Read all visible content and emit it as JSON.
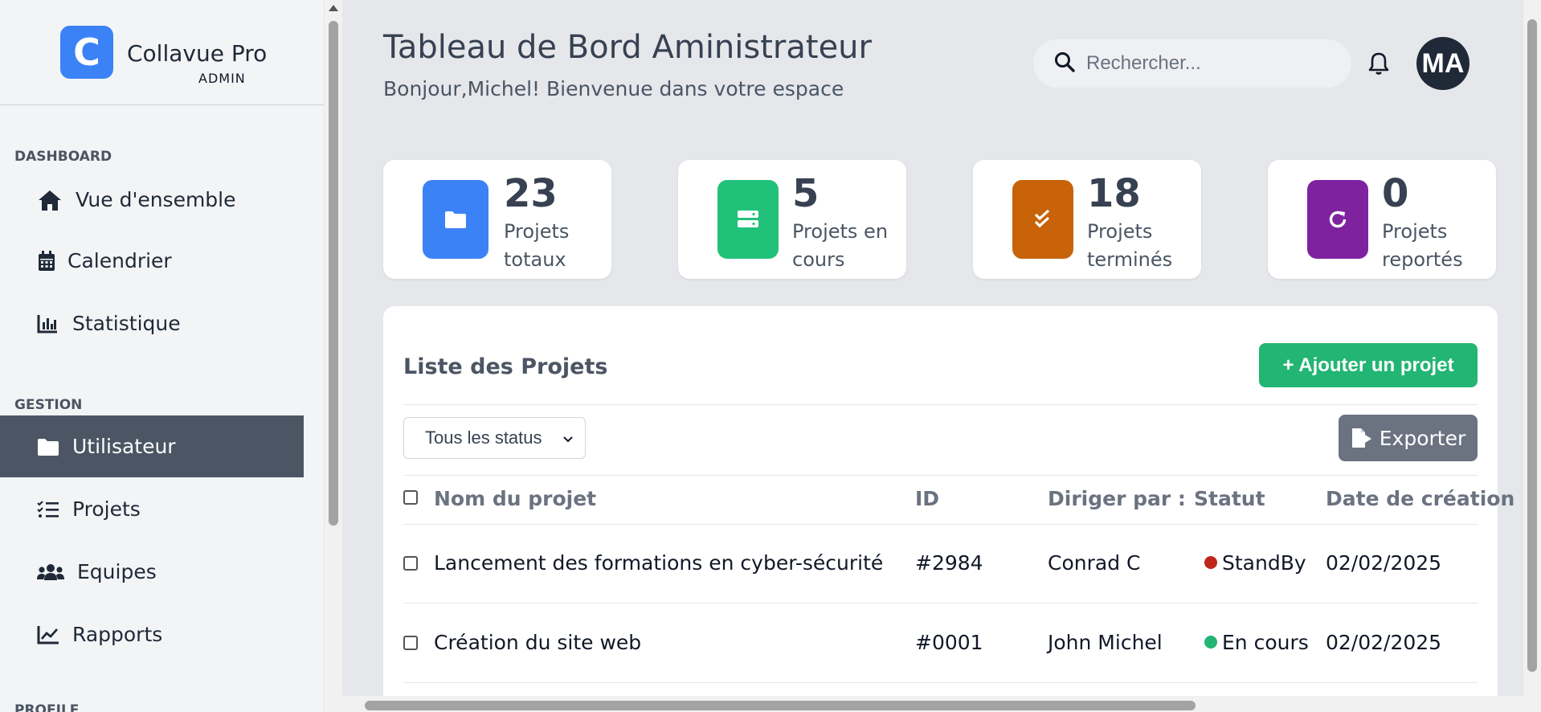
{
  "brand": {
    "logo_letter": "C",
    "name": "Collavue Pro",
    "role": "ADMIN",
    "color": "#3b82f6"
  },
  "sidebar": {
    "sections": [
      {
        "label": "DASHBOARD"
      },
      {
        "label": "GESTION"
      },
      {
        "label": "PROFILE"
      }
    ],
    "items": [
      {
        "label": "Vue d'ensemble",
        "icon": "home-icon"
      },
      {
        "label": "Calendrier",
        "icon": "calendar-icon"
      },
      {
        "label": "Statistique",
        "icon": "bar-chart-icon"
      },
      {
        "label": "Utilisateur",
        "icon": "folder-icon",
        "active": true
      },
      {
        "label": "Projets",
        "icon": "list-check-icon"
      },
      {
        "label": "Equipes",
        "icon": "users-icon"
      },
      {
        "label": "Rapports",
        "icon": "line-chart-icon"
      }
    ]
  },
  "header": {
    "title": "Tableau de Bord Aministrateur",
    "subtitle": "Bonjour,Michel! Bienvenue dans votre espace",
    "search_placeholder": "Rechercher...",
    "avatar_initials": "MA"
  },
  "stats": [
    {
      "value": "23",
      "label": "Projets totaux",
      "color": "#3b82f6",
      "icon": "folder-icon"
    },
    {
      "value": "5",
      "label": "Projets en cours",
      "color": "#22c17a",
      "icon": "server-icon"
    },
    {
      "value": "18",
      "label": "Projets terminés",
      "color": "#c8630a",
      "icon": "double-check-icon"
    },
    {
      "value": "0",
      "label": "Projets reportés",
      "color": "#7e22a0",
      "icon": "redo-icon"
    }
  ],
  "projects": {
    "title": "Liste des Projets",
    "add_button": "+ Ajouter un projet",
    "filter_value": "Tous les status",
    "export_button": "Exporter",
    "columns": [
      "Nom du projet",
      "ID",
      "Diriger par :",
      "Statut",
      "Date de création"
    ],
    "rows": [
      {
        "name": "Lancement des formations en cyber-sécurité",
        "id": "#2984",
        "lead": "Conrad C",
        "status": "StandBy",
        "status_color": "#c0261c",
        "date": "02/02/2025"
      },
      {
        "name": "Création du site web",
        "id": "#0001",
        "lead": "John Michel",
        "status": "En cours",
        "status_color": "#22b573",
        "date": "02/02/2025"
      }
    ]
  }
}
